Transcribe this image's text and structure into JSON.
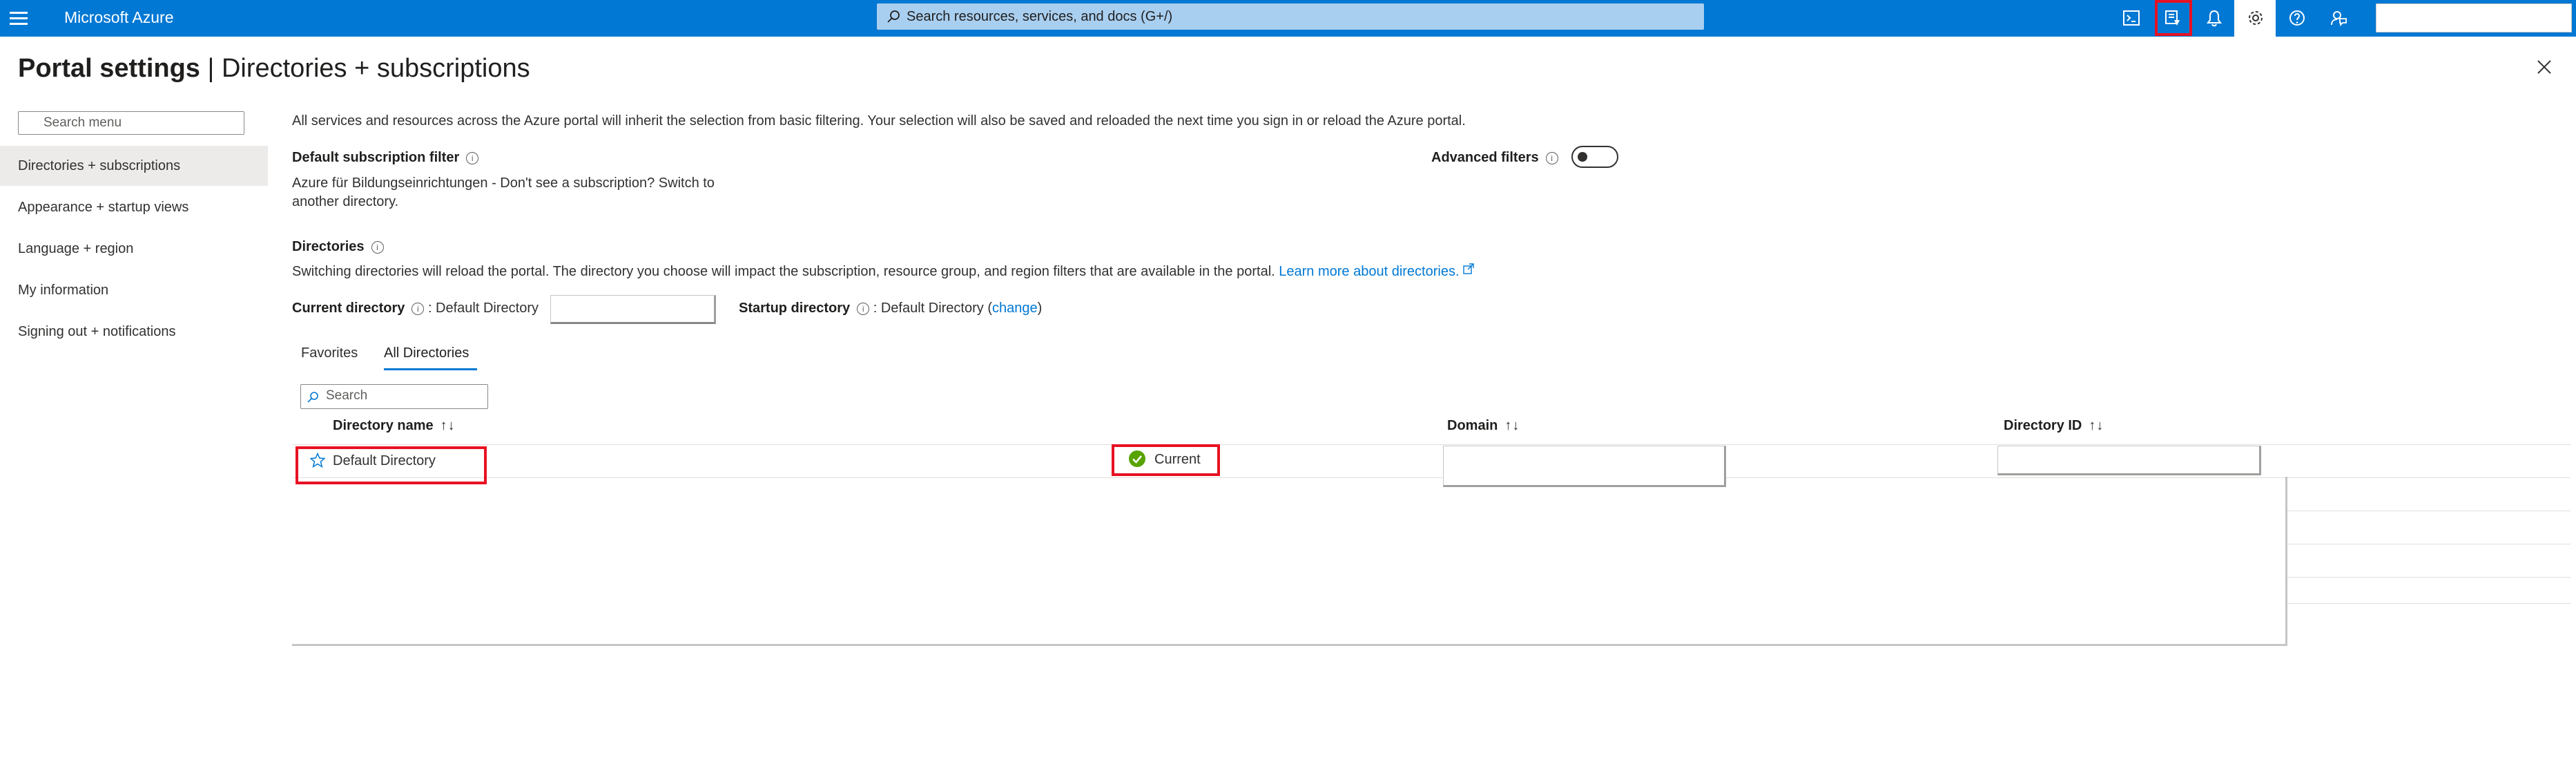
{
  "topbar": {
    "brand": "Microsoft Azure",
    "search_placeholder": "Search resources, services, and docs (G+/)",
    "icons": [
      "cloud-shell-icon",
      "directory-switch-icon",
      "notifications-icon",
      "settings-icon",
      "help-icon",
      "feedback-icon"
    ],
    "accent": "#0078d4"
  },
  "page": {
    "title_bold": "Portal settings",
    "title_sep": " | ",
    "title_rest": "Directories + subscriptions"
  },
  "menu": {
    "search_placeholder": "Search menu",
    "items": [
      {
        "label": "Directories + subscriptions",
        "selected": true
      },
      {
        "label": "Appearance + startup views"
      },
      {
        "label": "Language + region"
      },
      {
        "label": "My information"
      },
      {
        "label": "Signing out + notifications"
      }
    ]
  },
  "main": {
    "intro": "All services and resources across the Azure portal will inherit the selection from basic filtering. Your selection will also be saved and reloaded the next time you sign in or reload the Azure portal.",
    "default_filter_label": "Default subscription filter",
    "default_filter_text_1": "Azure für Bildungseinrichtungen - Don't see a subscription? Switch to",
    "default_filter_text_2": "another directory.",
    "advanced_filters_label": "Advanced filters",
    "directories_label": "Directories",
    "directories_desc": "Switching directories will reload the portal. The directory you choose will impact the subscription, resource group, and region filters that are available in the portal.",
    "learn_more": "Learn more about directories.",
    "current_dir_label": "Current directory",
    "current_dir_value": ": Default Directory",
    "startup_dir_label": "Startup directory",
    "startup_dir_value": ": Default Directory (",
    "change_link": "change",
    "startup_dir_close": ")"
  },
  "tabs": [
    {
      "label": "Favorites"
    },
    {
      "label": "All Directories",
      "active": true
    }
  ],
  "table": {
    "search_placeholder": "Search",
    "columns": [
      "Directory name",
      "Domain",
      "Directory ID"
    ],
    "sort_glyph": "↑↓",
    "rows": [
      {
        "name": "Default Directory",
        "status": "Current"
      }
    ]
  }
}
